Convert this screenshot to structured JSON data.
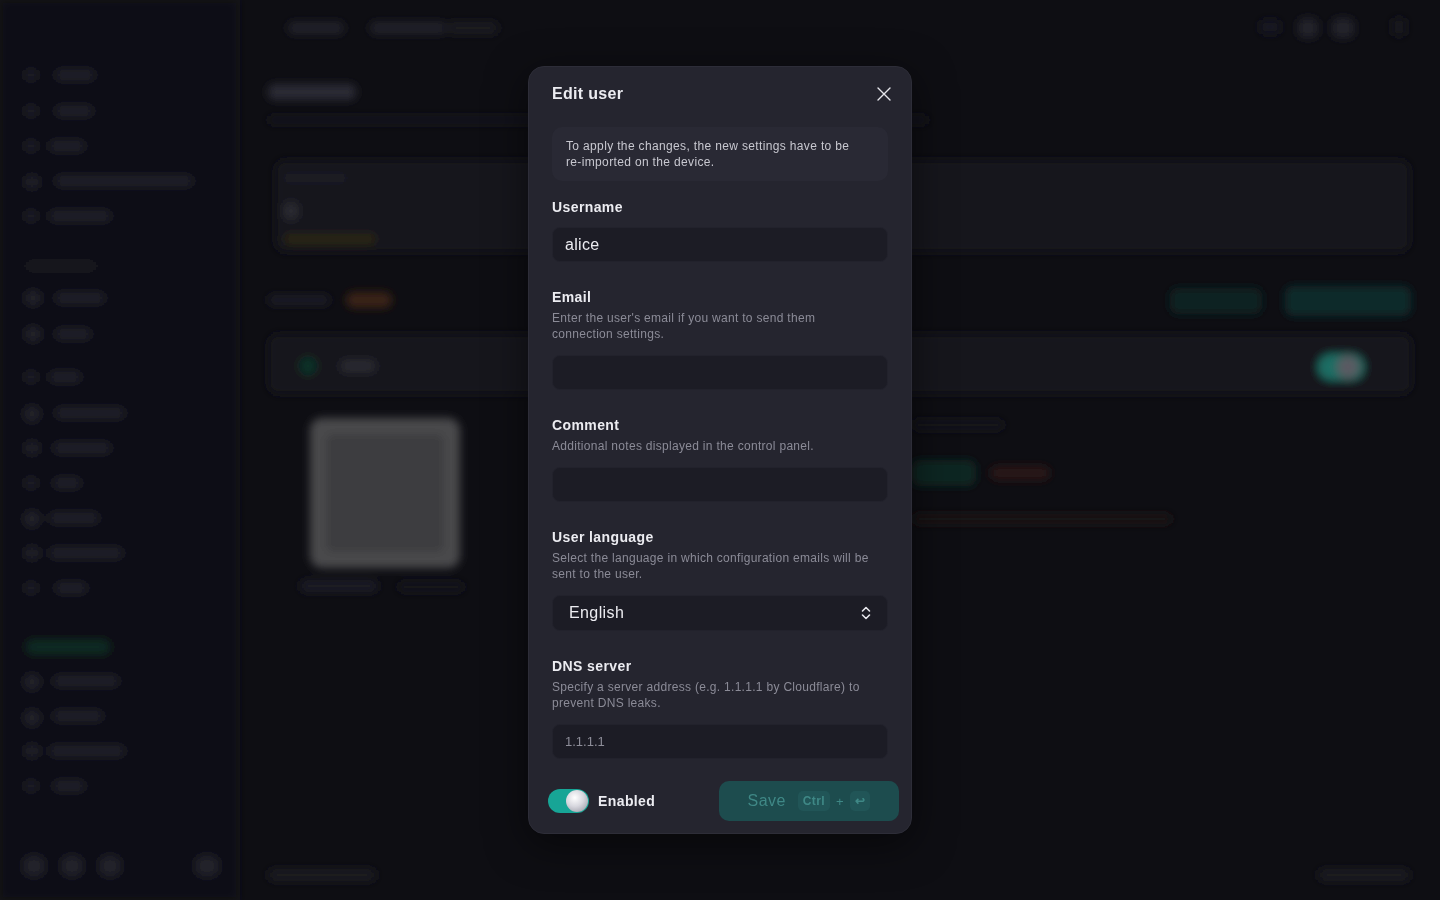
{
  "dialog": {
    "title": "Edit user",
    "notice": "To apply the changes, the new settings have to be re-imported on the device.",
    "fields": [
      {
        "kind": "text",
        "label": "Username",
        "value": "alice"
      },
      {
        "kind": "text",
        "label": "Email",
        "hint": "Enter the user's email if you want to send them connection settings."
      },
      {
        "kind": "text",
        "label": "Comment",
        "hint": "Additional notes displayed in the control panel."
      },
      {
        "kind": "select",
        "label": "User language",
        "hint": "Select the language in which configuration emails will be sent to the user.",
        "value": "English"
      },
      {
        "kind": "text",
        "label": "DNS server",
        "hint": "Specify a server address (e.g. 1.1.1.1 by Cloudflare) to prevent DNS leaks.",
        "placeholder": "1.1.1.1"
      }
    ],
    "enabled_toggle": {
      "label": "Enabled",
      "on": true
    },
    "save_button": {
      "label": "Save",
      "disabled": true,
      "shortcut": [
        {
          "kind": "key",
          "text": "Ctrl"
        },
        {
          "kind": "separator",
          "text": "+"
        },
        {
          "kind": "key",
          "text": "↩"
        }
      ]
    }
  }
}
